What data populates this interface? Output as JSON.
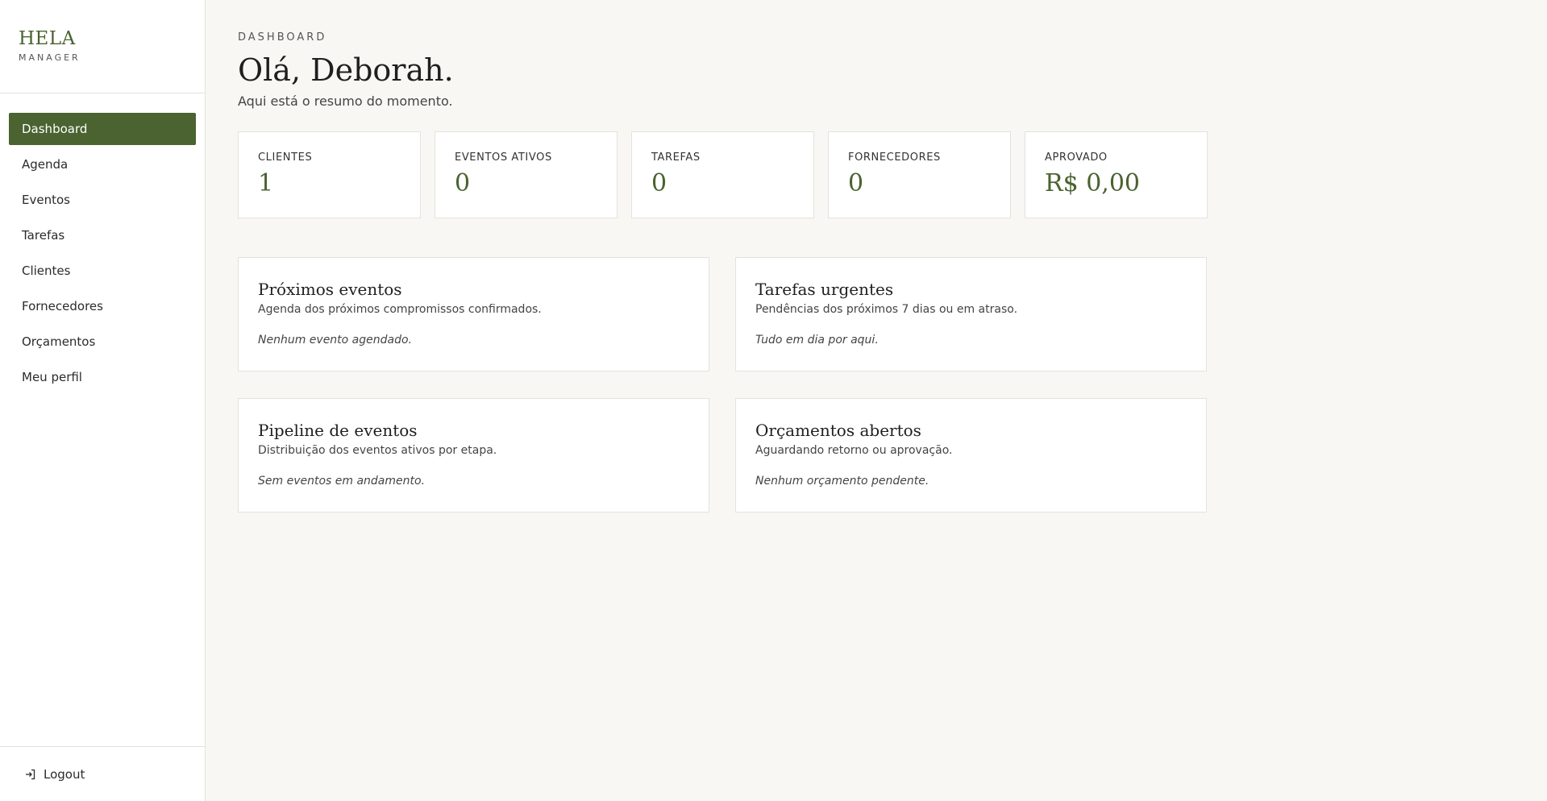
{
  "brand": {
    "name": "HELA",
    "sub": "MANAGER"
  },
  "sidebar": {
    "items": [
      {
        "label": "Dashboard",
        "active": true
      },
      {
        "label": "Agenda"
      },
      {
        "label": "Eventos"
      },
      {
        "label": "Tarefas"
      },
      {
        "label": "Clientes"
      },
      {
        "label": "Fornecedores"
      },
      {
        "label": "Orçamentos"
      },
      {
        "label": "Meu perfil"
      }
    ],
    "logout_label": "Logout",
    "logout_icon": "logout-icon"
  },
  "header": {
    "eyebrow": "DASHBOARD",
    "greeting": "Olá, Deborah.",
    "subtitle": "Aqui está o resumo do momento."
  },
  "stats": [
    {
      "label": "CLIENTES",
      "value": "1"
    },
    {
      "label": "EVENTOS ATIVOS",
      "value": "0"
    },
    {
      "label": "TAREFAS",
      "value": "0"
    },
    {
      "label": "FORNECEDORES",
      "value": "0"
    },
    {
      "label": "APROVADO",
      "value": "R$ 0,00"
    }
  ],
  "panels": [
    {
      "title": "Próximos eventos",
      "desc": "Agenda dos próximos compromissos confirmados.",
      "empty": "Nenhum evento agendado."
    },
    {
      "title": "Tarefas urgentes",
      "desc": "Pendências dos próximos 7 dias ou em atraso.",
      "empty": "Tudo em dia por aqui."
    },
    {
      "title": "Pipeline de eventos",
      "desc": "Distribuição dos eventos ativos por etapa.",
      "empty": "Sem eventos em andamento."
    },
    {
      "title": "Orçamentos abertos",
      "desc": "Aguardando retorno ou aprovação.",
      "empty": "Nenhum orçamento pendente."
    }
  ],
  "colors": {
    "accent": "#4a6330",
    "background": "#f8f7f4",
    "card": "#ffffff",
    "border": "#e4e2dc"
  }
}
